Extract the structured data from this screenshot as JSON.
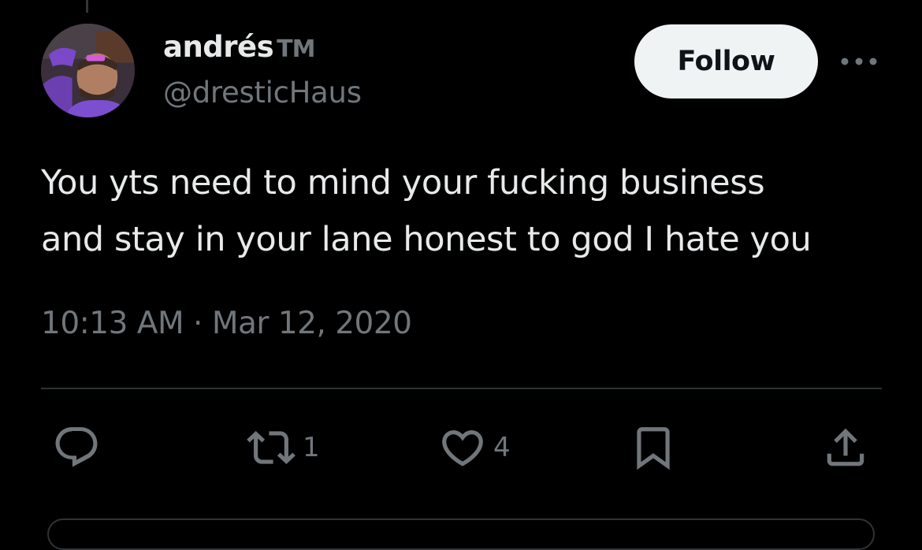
{
  "tweet": {
    "author": {
      "display_name": "andrés",
      "name_suffix": "TM",
      "handle": "@dresticHaus"
    },
    "follow_label": "Follow",
    "text_lines": [
      "You yts need to mind your fucking business",
      "and stay in your lane honest to god I hate you"
    ],
    "time": "10:13 AM",
    "separator": "·",
    "date": "Mar 12, 2020",
    "actions": {
      "reply": {
        "icon": "reply-icon"
      },
      "retweet": {
        "icon": "retweet-icon",
        "count": "1"
      },
      "like": {
        "icon": "heart-icon",
        "count": "4"
      },
      "bookmark": {
        "icon": "bookmark-icon"
      },
      "share": {
        "icon": "share-icon"
      }
    }
  },
  "colors": {
    "background": "#000000",
    "primary_text": "#e7e9ea",
    "secondary_text": "#71767b",
    "divider": "#2f3336",
    "follow_bg": "#eff3f4",
    "follow_text": "#0f1419"
  }
}
